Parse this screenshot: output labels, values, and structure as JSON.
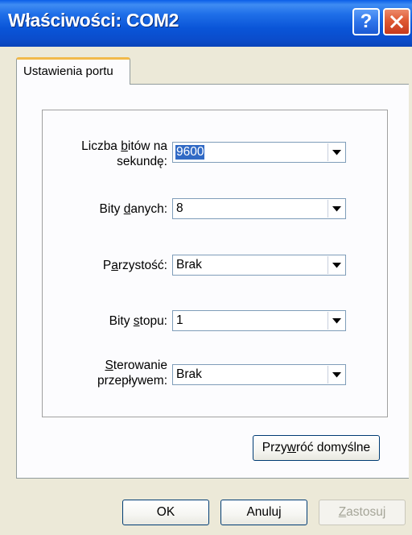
{
  "window": {
    "title": "Właściwości: COM2"
  },
  "titlebar": {
    "help_label": "?",
    "close_icon": "close-icon"
  },
  "tabs": [
    {
      "label": "Ustawienia portu",
      "active": true
    }
  ],
  "fields": {
    "baud": {
      "label_line1_pre": "Liczba ",
      "label_line1_acc": "b",
      "label_line1_post": "itów na",
      "label_line2": "sekundę:",
      "value": "9600"
    },
    "data_bits": {
      "label_pre": "Bity ",
      "label_acc": "d",
      "label_post": "anych:",
      "value": "8"
    },
    "parity": {
      "label_pre": "P",
      "label_acc": "a",
      "label_post": "rzystość:",
      "value": "Brak"
    },
    "stop_bits": {
      "label_pre": "Bity ",
      "label_acc": "s",
      "label_post": "topu:",
      "value": "1"
    },
    "flow_control": {
      "label_line1_acc": "S",
      "label_line1_post": "terowanie",
      "label_line2": "przepływem:",
      "value": "Brak"
    }
  },
  "buttons": {
    "restore_pre": "Przy",
    "restore_acc": "w",
    "restore_post": "róć domyślne",
    "ok": "OK",
    "cancel": "Anuluj",
    "apply_acc": "Z",
    "apply_post": "astosuj"
  },
  "colors": {
    "titlebar": "#0a55d8",
    "tab_highlight": "#f1b94a",
    "selection": "#316ac5",
    "dialog_bg": "#ece9d8"
  }
}
